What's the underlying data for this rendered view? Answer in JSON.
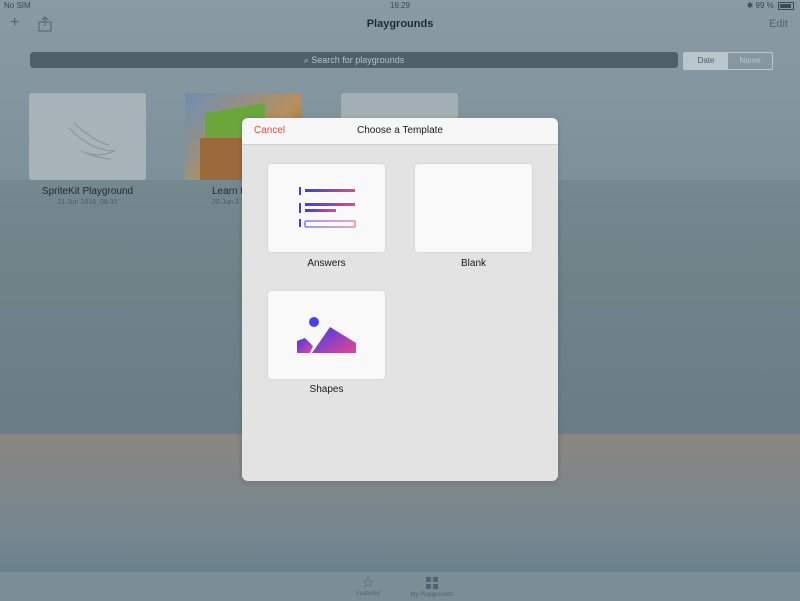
{
  "status_bar": {
    "carrier": "No SIM",
    "time": "16:29",
    "battery": "99 %"
  },
  "nav": {
    "title": "Playgrounds",
    "edit_label": "Edit"
  },
  "search": {
    "placeholder": "Search for playgrounds"
  },
  "sort": {
    "options": [
      "Date",
      "Name"
    ],
    "selected": "Date"
  },
  "playgrounds": [
    {
      "title": "SpriteKit Playground",
      "date": "21 Jun 2016, 08:32"
    },
    {
      "title": "Learn t",
      "date": "20 Jun 2"
    },
    {
      "title": "",
      "date": ""
    }
  ],
  "tab_bar": {
    "items": [
      {
        "label": "Featured",
        "icon": "star-icon"
      },
      {
        "label": "My Playgrounds",
        "icon": "grid-icon"
      }
    ]
  },
  "modal": {
    "title": "Choose a Template",
    "cancel_label": "Cancel",
    "templates": [
      {
        "label": "Answers",
        "icon": "answers-template-icon"
      },
      {
        "label": "Blank",
        "icon": "blank-template-icon"
      },
      {
        "label": "Shapes",
        "icon": "shapes-template-icon"
      }
    ]
  },
  "colors": {
    "accent": "#e64a3a",
    "modal_bg": "#e3e3e3",
    "gradient_start": "#3c3cf0",
    "gradient_end": "#e8458f"
  }
}
